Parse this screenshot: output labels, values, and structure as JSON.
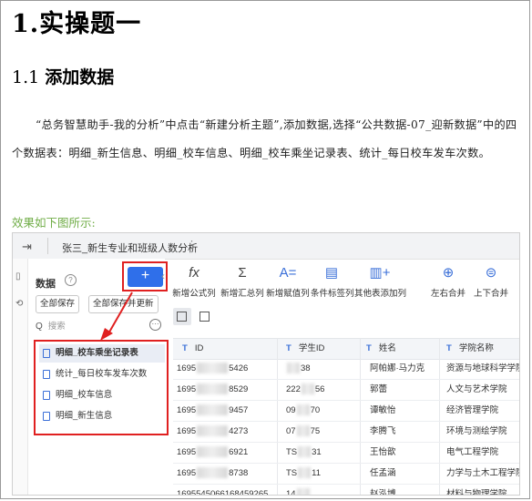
{
  "heading1": "1.实操题一",
  "heading2_num": "1.1",
  "heading2_text": "添加数据",
  "paragraph": "“总务智慧助手-我的分析”中点击“新建分析主题”,添加数据,选择“公共数据-07_迎新数据”中的四个数据表：明细_新生信息、明细_校车信息、明细_校车乘坐记录表、统计_每日校车发车次数。",
  "caption": "效果如下图所示:",
  "app": {
    "exit_icon": "exit-icon",
    "title": "张三_新生专业和班级人数分析",
    "more": "⋮",
    "rail_icons": [
      "▯",
      "⟲"
    ],
    "panel_title": "数据",
    "add_label": "+",
    "save_all": "全部保存",
    "save_all_update": "全部保存并更新",
    "search_placeholder": "搜索",
    "tables": [
      "明细_校车乘坐记录表",
      "统计_每日校车发车次数",
      "明细_校车信息",
      "明细_新生信息"
    ],
    "toolbar": [
      {
        "icon": "fx",
        "label": "新增公式列"
      },
      {
        "icon": "Σ",
        "label": "新增汇总列"
      },
      {
        "icon": "A=",
        "label": "新增赋值列"
      },
      {
        "icon": "▤",
        "label": "条件标签列"
      },
      {
        "icon": "▥+",
        "label": "其他表添加列"
      },
      {
        "icon": "⊕",
        "label": "左右合并"
      },
      {
        "icon": "⊜",
        "label": "上下合并"
      }
    ],
    "columns": [
      "ID",
      "学生ID",
      "姓名",
      "学院名称"
    ],
    "col_type": "T",
    "rows": [
      {
        "id_a": "1695",
        "id_b": "5426",
        "sid_a": "",
        "sid_b": "38",
        "name": "阿帕娜·马力克",
        "college": "资源与地球科学学院"
      },
      {
        "id_a": "1695",
        "id_b": "8529",
        "sid_a": "222",
        "sid_b": "56",
        "name": "郭蕾",
        "college": "人文与艺术学院"
      },
      {
        "id_a": "1695",
        "id_b": "9457",
        "sid_a": "09",
        "sid_b": "70",
        "name": "谭敏怡",
        "college": "经济管理学院"
      },
      {
        "id_a": "1695",
        "id_b": "4273",
        "sid_a": "07",
        "sid_b": "75",
        "name": "李腾飞",
        "college": "环境与测绘学院"
      },
      {
        "id_a": "1695",
        "id_b": "6921",
        "sid_a": "TS",
        "sid_b": "31",
        "name": "王怡歆",
        "college": "电气工程学院"
      },
      {
        "id_a": "1695",
        "id_b": "8738",
        "sid_a": "TS",
        "sid_b": "11",
        "name": "任孟涵",
        "college": "力学与土木工程学院"
      },
      {
        "id_a": "16955450661684",
        "id_b": "59265",
        "sid_a": "14",
        "sid_b": "",
        "name": "赵泓博",
        "college": "材料与物理学院"
      }
    ]
  },
  "colors": {
    "accent": "#2f6fea",
    "highlight": "#e02020",
    "caption": "#70ad47"
  }
}
